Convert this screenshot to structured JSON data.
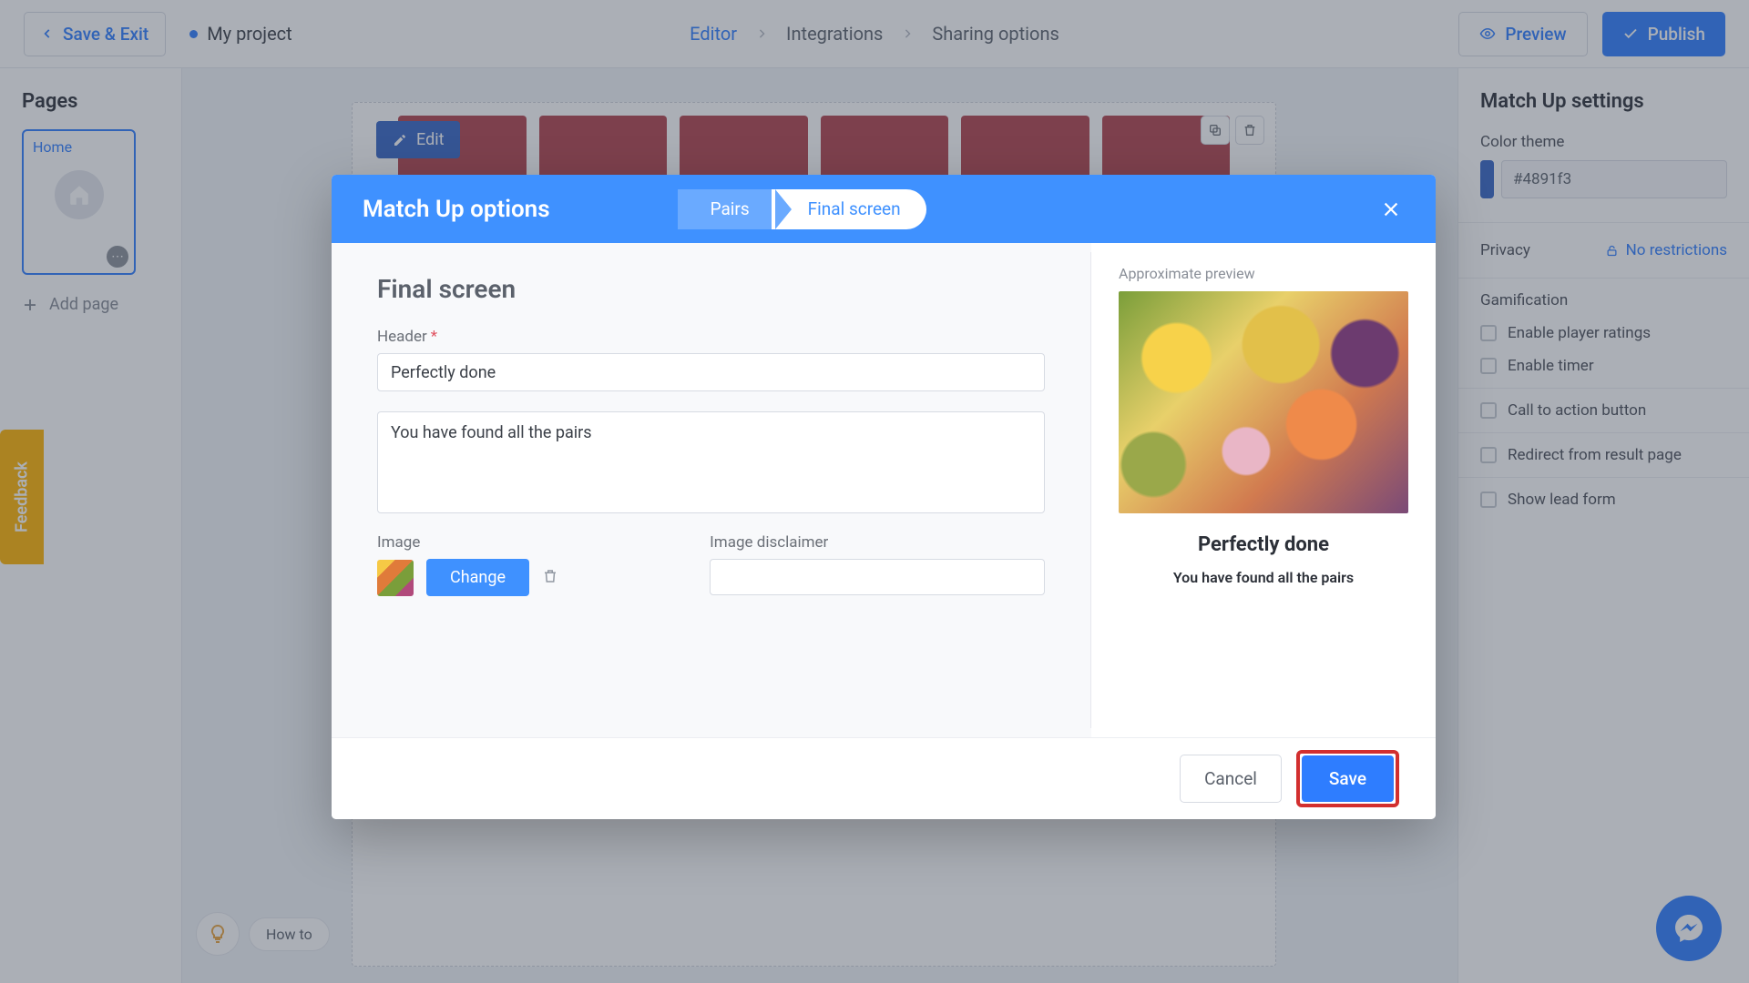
{
  "topbar": {
    "save_exit": "Save & Exit",
    "project": "My project",
    "crumbs": {
      "editor": "Editor",
      "integrations": "Integrations",
      "sharing": "Sharing options"
    },
    "preview": "Preview",
    "publish": "Publish"
  },
  "left": {
    "title": "Pages",
    "page1": "Home",
    "add": "Add page"
  },
  "right": {
    "title": "Match Up settings",
    "color_theme_label": "Color theme",
    "color_value": "#4891f3",
    "privacy_label": "Privacy",
    "privacy_value": "No restrictions",
    "gamification_label": "Gamification",
    "cb_ratings": "Enable player ratings",
    "cb_timer": "Enable timer",
    "cb_cta": "Call to action button",
    "cb_redirect": "Redirect from result page",
    "cb_lead": "Show lead form"
  },
  "canvas": {
    "edit": "Edit"
  },
  "howto": {
    "label": "How to"
  },
  "feedback": {
    "label": "Feedback"
  },
  "modal": {
    "title": "Match Up options",
    "tab_pairs": "Pairs",
    "tab_final": "Final screen",
    "heading": "Final screen",
    "header_label": "Header",
    "header_value": "Perfectly done",
    "desc_value": "You have found all the pairs",
    "image_label": "Image",
    "disclaimer_label": "Image disclaimer",
    "change": "Change",
    "preview_label": "Approximate preview",
    "preview_title": "Perfectly done",
    "preview_sub": "You have found all the pairs",
    "cancel": "Cancel",
    "save": "Save"
  }
}
